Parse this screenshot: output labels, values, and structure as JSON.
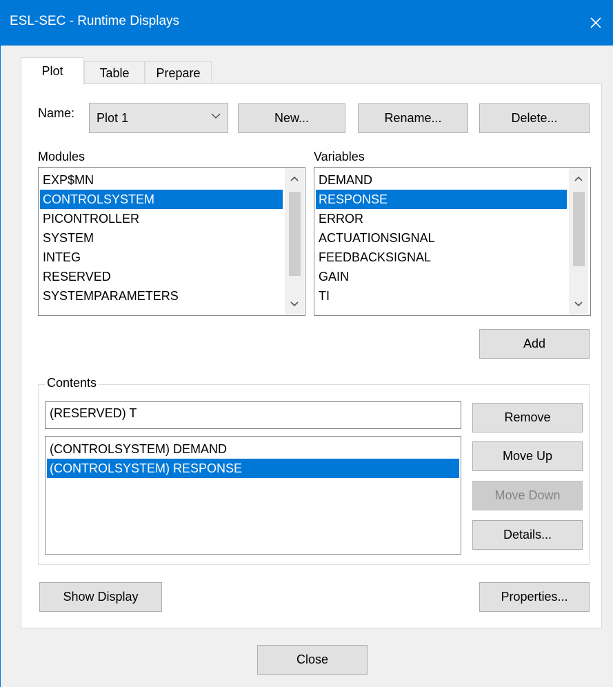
{
  "window": {
    "title": "ESL-SEC - Runtime Displays",
    "close_icon": "×"
  },
  "tabs": [
    {
      "label": "Plot",
      "active": true
    },
    {
      "label": "Table",
      "active": false
    },
    {
      "label": "Prepare",
      "active": false
    }
  ],
  "name_row": {
    "label": "Name:",
    "selected": "Plot 1",
    "new_label": "New...",
    "rename_label": "Rename...",
    "delete_label": "Delete..."
  },
  "modules": {
    "label": "Modules",
    "items": [
      "EXP$MN",
      "CONTROLSYSTEM",
      "PICONTROLLER",
      "SYSTEM",
      "INTEG",
      "RESERVED",
      "SYSTEMPARAMETERS"
    ],
    "selected_index": 1
  },
  "variables": {
    "label": "Variables",
    "items": [
      "DEMAND",
      "RESPONSE",
      "ERROR",
      "ACTUATIONSIGNAL",
      "FEEDBACKSIGNAL",
      "GAIN",
      "TI"
    ],
    "selected_index": 1
  },
  "add_label": "Add",
  "contents": {
    "label": "Contents",
    "x_variable": "(RESERVED) T",
    "items": [
      "(CONTROLSYSTEM) DEMAND",
      "(CONTROLSYSTEM) RESPONSE"
    ],
    "selected_index": 1,
    "remove_label": "Remove",
    "move_up_label": "Move Up",
    "move_down_label": "Move Down",
    "details_label": "Details..."
  },
  "show_display_label": "Show Display",
  "properties_label": "Properties...",
  "close_label": "Close",
  "colors": {
    "titlebar": "#0078d7",
    "selection": "#0078d7"
  }
}
